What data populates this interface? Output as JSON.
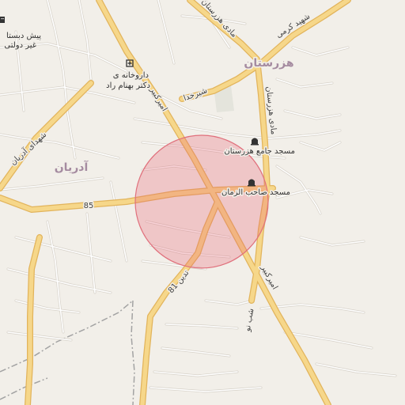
{
  "map": {
    "colors": {
      "background": "#f2efe9",
      "minor_road": "#ffffff",
      "minor_road_casing": "#d6d1c8",
      "major_road": "#f6d78a",
      "major_road_casing": "#e2b45c",
      "boundary": "#a3a3a3",
      "park": "#cfe3c3",
      "place_label": "#a58ba0",
      "highlight_fill": "rgba(232,95,110,0.28)",
      "highlight_stroke": "#e0707c"
    },
    "places": {
      "hezarestan": "هزرستان",
      "adrian": "آدریان"
    },
    "pois": {
      "mosque_hezarestan": "مسجد جامع هزرستان",
      "mosque_saheb": "مسجد صاحب الزمان",
      "pharmacy_line1": "داروخانه ی",
      "pharmacy_line2": "دکتر بهنام راد",
      "school_line1": "پیش دبستا",
      "school_line2": "غیر دولتی"
    },
    "roads": {
      "amir_kabir_north": "امیرکبیر",
      "amir_kabir_south": "امیرکبیر",
      "shahid_karami": "شهید کرمی",
      "shahid_adrian": "شهدای آدریان",
      "madi_hezarestan_north": "مادی هزرستان",
      "madi_hezarestan_east": "مادی هزرستان",
      "shabnoo": "شب نو",
      "taddin": "تدین 81",
      "route_85": "85",
      "shirkhoda": "شیرخدا"
    },
    "icons": {
      "mosque": "mosque-icon",
      "pharmacy": "pharmacy-icon",
      "school": "school-icon"
    },
    "highlight": {
      "shape": "circle"
    }
  }
}
